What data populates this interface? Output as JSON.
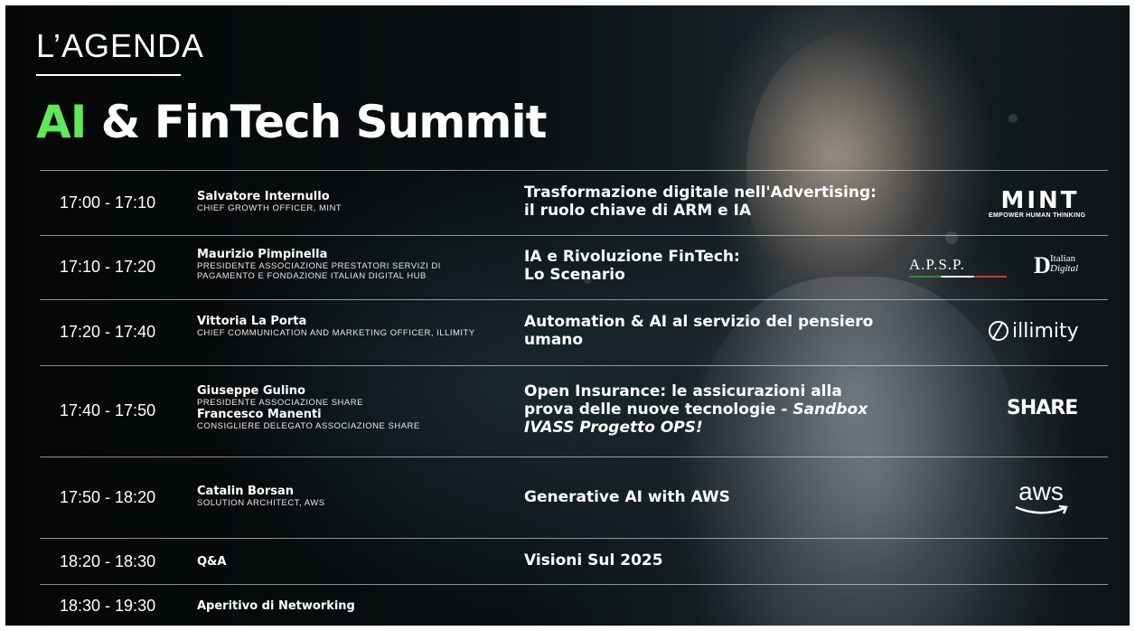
{
  "header": {
    "agenda_label": "L’AGENDA",
    "title_accent": "AI",
    "title_rest": "& FinTech Summit"
  },
  "colors": {
    "accent": "#5ee85a",
    "text": "#ffffff",
    "background": "#0a0f11"
  },
  "agenda": [
    {
      "time": "17:00 - 17:10",
      "speakers": [
        {
          "name": "Salvatore Internullo",
          "role": "CHIEF GROWTH OFFICER, MINT"
        }
      ],
      "session_line1": "Trasformazione digitale nell'Advertising:",
      "session_line2": "il ruolo chiave di ARM e IA",
      "logos": [
        {
          "name": "mint-logo",
          "text": "MINT",
          "tagline": "EMPOWER HUMAN THINKING"
        }
      ]
    },
    {
      "time": "17:10 - 17:20",
      "speakers": [
        {
          "name": "Maurizio Pimpinella",
          "role": "PRESIDENTE ASSOCIAZIONE PRESTATORI SERVIZI DI PAGAMENTO E FONDAZIONE ITALIAN DIGITAL HUB"
        }
      ],
      "session_line1": "IA e Rivoluzione FinTech:",
      "session_line2": "Lo Scenario",
      "logos": [
        {
          "name": "apsp-logo",
          "text": "A.P.S.P."
        },
        {
          "name": "italian-digital-hub-logo",
          "text_line1": "Italian",
          "text_line2": "Digital"
        }
      ]
    },
    {
      "time": "17:20 - 17:40",
      "speakers": [
        {
          "name": "Vittoria La Porta",
          "role": "CHIEF COMMUNICATION AND MARKETING OFFICER, ILLIMITY"
        }
      ],
      "session_line1": "Automation & AI al servizio del pensiero",
      "session_line2": "umano",
      "logos": [
        {
          "name": "illimity-logo",
          "text": "illimity"
        }
      ]
    },
    {
      "time": "17:40 - 17:50",
      "speakers": [
        {
          "name": "Giuseppe Gulino",
          "role": "PRESIDENTE ASSOCIAZIONE SHARE"
        },
        {
          "name": "Francesco Manenti",
          "role": "CONSIGLIERE DELEGATO ASSOCIAZIONE SHARE"
        }
      ],
      "session_line1": "Open Insurance: le assicurazioni alla",
      "session_line2_plain": "prova delle nuove tecnologie - ",
      "session_line2_italic": "Sandbox",
      "session_line3_italic": "IVASS Progetto OPS!",
      "logos": [
        {
          "name": "share-logo",
          "text": "SHARE"
        }
      ]
    },
    {
      "time": "17:50 - 18:20",
      "speakers": [
        {
          "name": "Catalin Borsan",
          "role": "SOLUTION ARCHITECT, AWS"
        }
      ],
      "session_line1": "Generative AI with AWS",
      "logos": [
        {
          "name": "aws-logo",
          "text": "aws"
        }
      ]
    },
    {
      "time": "18:20 - 18:30",
      "speakers": [
        {
          "name": "Q&A"
        }
      ],
      "session_line1": "Visioni Sul 2025"
    },
    {
      "time": "18:30 - 19:30",
      "speakers": [
        {
          "name": "Aperitivo di Networking"
        }
      ]
    }
  ]
}
